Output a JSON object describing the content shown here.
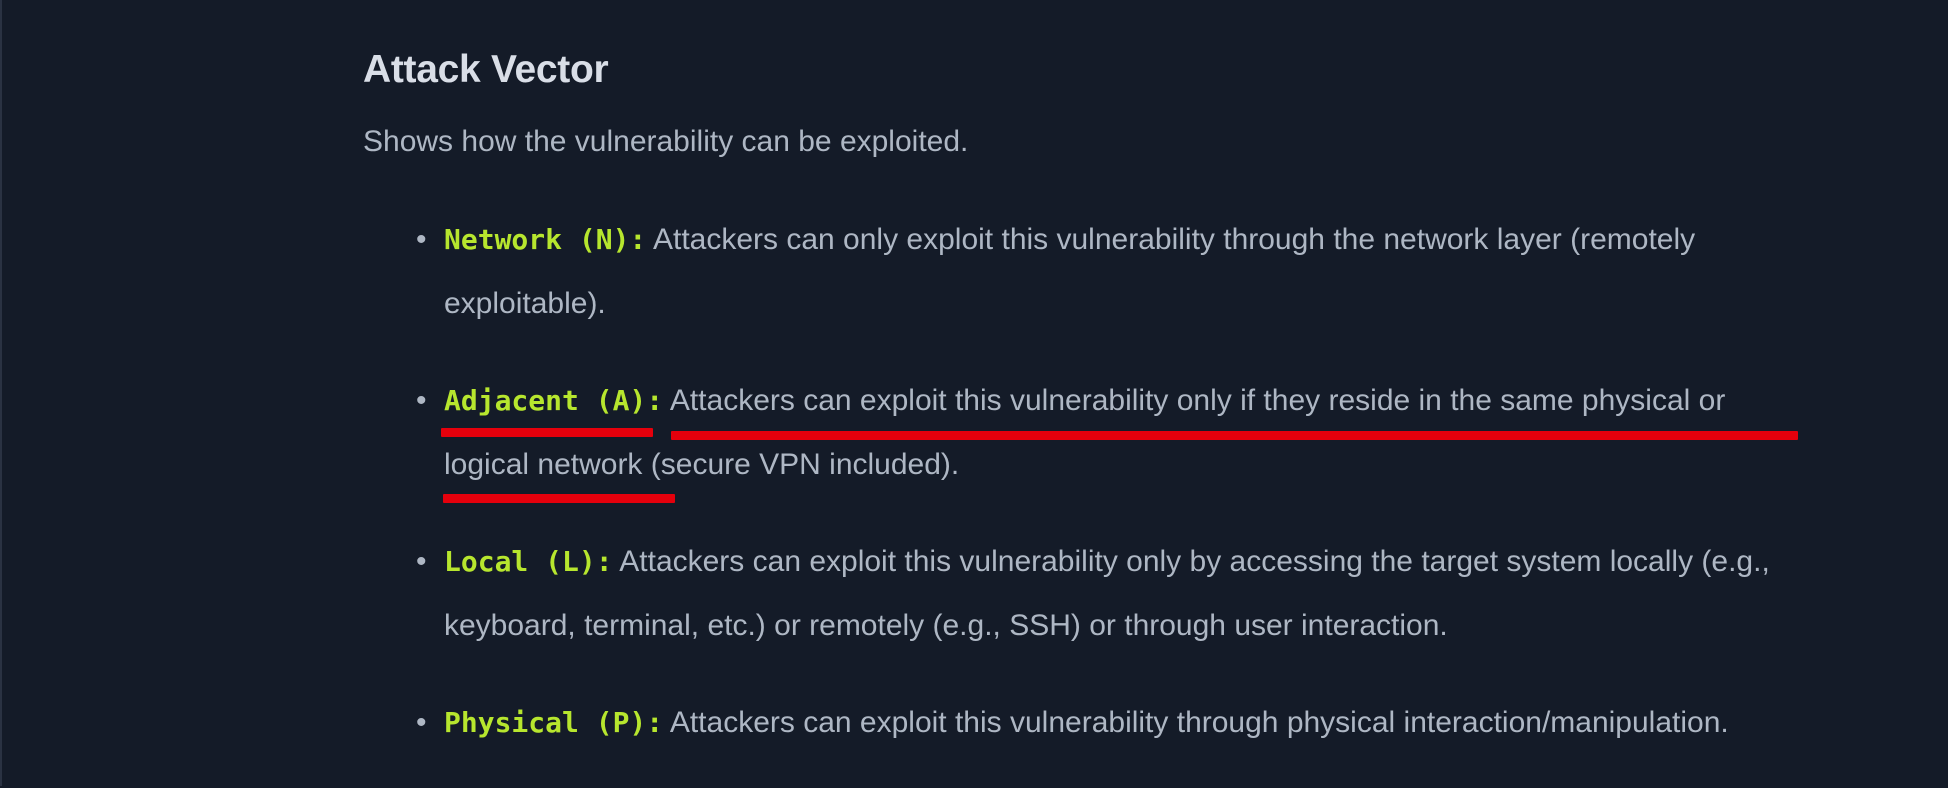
{
  "section": {
    "heading": "Attack Vector",
    "description": "Shows how the vulnerability can be exploited."
  },
  "vectors": [
    {
      "code": "Network (N):",
      "line1": " Attackers can only exploit this vulnerability through the network layer (remotely",
      "line2": "exploitable)."
    },
    {
      "code": "Adjacent (A):",
      "line1": " Attackers can exploit this vulnerability only if they reside in the same physical or",
      "line2": "logical network (secure VPN included)."
    },
    {
      "code": "Local (L):",
      "line1": " Attackers can exploit this vulnerability only by accessing the target system locally (e.g.,",
      "line2": "keyboard, terminal, etc.) or remotely (e.g., SSH) or through user interaction."
    },
    {
      "code": "Physical (P):",
      "line1": " Attackers can exploit this vulnerability through physical interaction/manipulation."
    }
  ],
  "colors": {
    "background": "#141b28",
    "heading": "#d9dee7",
    "body_text": "#aeb7c4",
    "code_accent": "#b7e62e",
    "annotation_underline": "#e5000c"
  }
}
